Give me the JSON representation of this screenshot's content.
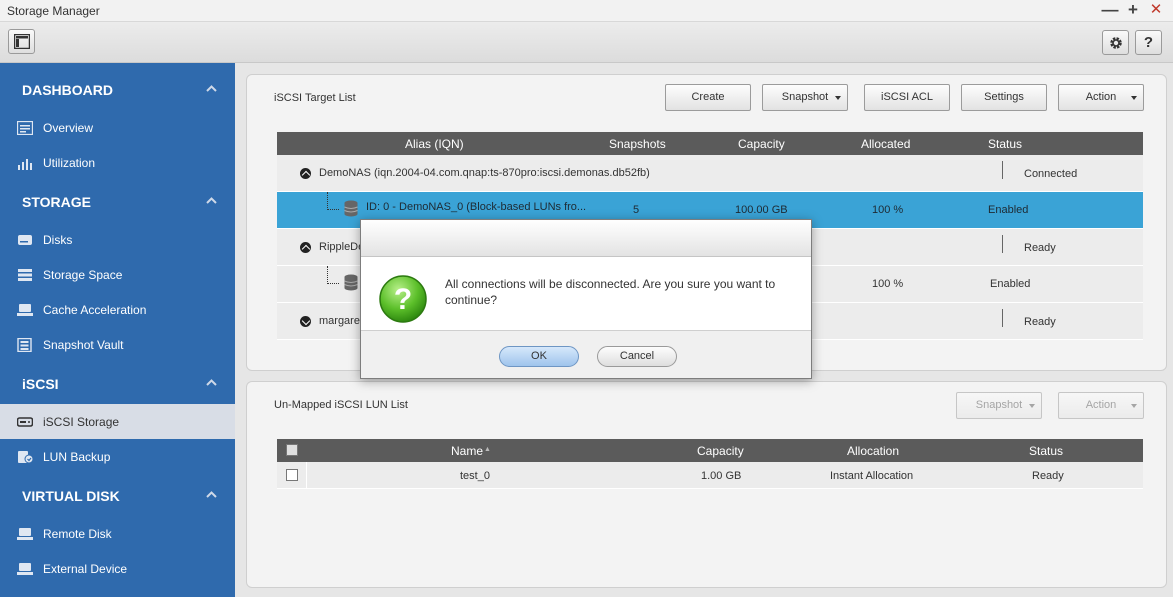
{
  "window": {
    "title": "Storage Manager",
    "minimize": "—",
    "maximize": "+",
    "close": "✕"
  },
  "toolbar": {
    "left_icon": "panel-layout-icon",
    "settings_icon": "gear-icon",
    "help_label": "?"
  },
  "sidebar": {
    "sections": [
      {
        "label": "DASHBOARD",
        "items": [
          {
            "label": "Overview",
            "icon": "overview-icon"
          },
          {
            "label": "Utilization",
            "icon": "utilization-icon"
          }
        ]
      },
      {
        "label": "STORAGE",
        "items": [
          {
            "label": "Disks",
            "icon": "disk-icon"
          },
          {
            "label": "Storage Space",
            "icon": "storage-space-icon"
          },
          {
            "label": "Cache Acceleration",
            "icon": "cache-icon"
          },
          {
            "label": "Snapshot Vault",
            "icon": "snapshot-vault-icon"
          }
        ]
      },
      {
        "label": "iSCSI",
        "items": [
          {
            "label": "iSCSI Storage",
            "icon": "iscsi-storage-icon",
            "active": true
          },
          {
            "label": "LUN Backup",
            "icon": "lun-backup-icon"
          }
        ]
      },
      {
        "label": "VIRTUAL DISK",
        "items": [
          {
            "label": "Remote Disk",
            "icon": "remote-disk-icon"
          },
          {
            "label": "External Device",
            "icon": "external-device-icon"
          }
        ]
      }
    ]
  },
  "target_panel": {
    "title": "iSCSI Target List",
    "buttons": {
      "create": "Create",
      "snapshot": "Snapshot",
      "acl": "iSCSI ACL",
      "settings": "Settings",
      "action": "Action"
    },
    "columns": {
      "alias": "Alias (IQN)",
      "snapshots": "Snapshots",
      "capacity": "Capacity",
      "allocated": "Allocated",
      "status": "Status"
    },
    "rows": [
      {
        "alias": "DemoNAS (iqn.2004-04.com.qnap:ts-870pro:iscsi.demonas.db52fb)",
        "status": "Connected"
      },
      {
        "alias": "ID: 0 - DemoNAS_0 (Block-based LUNs fro...",
        "snapshots": "5",
        "capacity": "100.00 GB",
        "allocated": "100 %",
        "status": "Enabled"
      },
      {
        "alias": "RippleDe",
        "status": "Ready"
      },
      {
        "allocated": "100 %",
        "status": "Enabled"
      },
      {
        "alias": "margaret",
        "status": "Ready"
      }
    ]
  },
  "lun_panel": {
    "title": "Un-Mapped iSCSI LUN List",
    "buttons": {
      "snapshot": "Snapshot",
      "action": "Action"
    },
    "columns": {
      "name": "Name",
      "sort": "▲",
      "capacity": "Capacity",
      "allocation": "Allocation",
      "status": "Status"
    },
    "rows": [
      {
        "name": "test_0",
        "capacity": "1.00 GB",
        "allocation": "Instant Allocation",
        "status": "Ready"
      }
    ]
  },
  "dialog": {
    "icon": "question-icon",
    "glyph": "?",
    "message": "All connections will be disconnected. Are you sure you want to continue?",
    "ok": "OK",
    "cancel": "Cancel"
  },
  "colors": {
    "sidebar": "#2f6aad",
    "selected_row": "#3aa3d6",
    "header": "#5b5b5b",
    "question_green": "#5cbf2a"
  }
}
